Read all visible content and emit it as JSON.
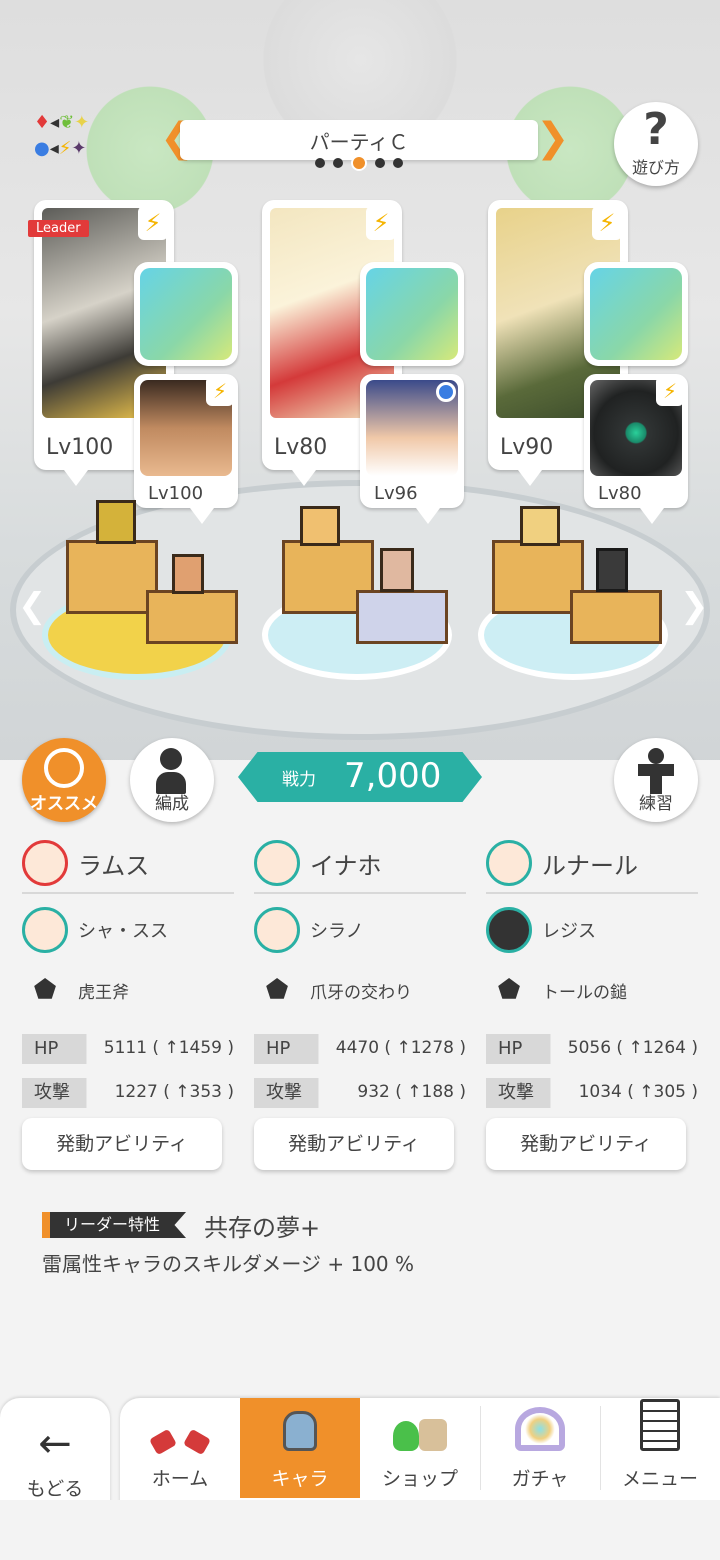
{
  "header": {
    "party_title": "パーティＣ",
    "page_dots": 5,
    "active_dot": 2,
    "help_label": "遊び方",
    "help_glyph": "?",
    "prev_glyph": "❮",
    "next_glyph": "❯"
  },
  "element_legend": [
    "♦",
    "◂",
    "❦",
    "✦",
    "●",
    "◂",
    "⚡",
    "✦"
  ],
  "leader_badge": "Leader",
  "bolt_glyph": "⚡",
  "stage_arrows": {
    "left": "❮",
    "right": "❯"
  },
  "party": [
    {
      "main_level": "Lv100",
      "sub_level": "Lv100"
    },
    {
      "main_level": "Lv80",
      "sub_level": "Lv96"
    },
    {
      "main_level": "Lv90",
      "sub_level": "Lv80"
    }
  ],
  "controls": {
    "recommend_label": "オススメ",
    "formation_label": "編成",
    "power_label": "戦力",
    "power_value": "7,000",
    "practice_label": "練習"
  },
  "columns": [
    {
      "main_name": "ラムス",
      "sub_name": "シャ・スス",
      "weapon": "虎王斧",
      "hp_label": "HP",
      "hp_value": "5111 ( ↑1459 )",
      "atk_label": "攻撃",
      "atk_value": "1227 ( ↑353 )",
      "ability_button": "発動アビリティ"
    },
    {
      "main_name": "イナホ",
      "sub_name": "シラノ",
      "weapon": "爪牙の交わり",
      "hp_label": "HP",
      "hp_value": "4470 ( ↑1278 )",
      "atk_label": "攻撃",
      "atk_value": "932 ( ↑188 )",
      "ability_button": "発動アビリティ"
    },
    {
      "main_name": "ルナール",
      "sub_name": "レジス",
      "weapon": "トールの鎚",
      "hp_label": "HP",
      "hp_value": "5056 ( ↑1264 )",
      "atk_label": "攻撃",
      "atk_value": "1034 ( ↑305 )",
      "ability_button": "発動アビリティ"
    }
  ],
  "leader_trait": {
    "tag": "リーダー特性",
    "name": "共存の夢+",
    "description": "雷属性キャラのスキルダメージ + 100 %"
  },
  "nav": {
    "back_label": "もどる",
    "back_glyph": "←",
    "tabs": [
      {
        "label": "ホーム",
        "icon": "home-icon"
      },
      {
        "label": "キャラ",
        "icon": "character-icon",
        "active": true
      },
      {
        "label": "ショップ",
        "icon": "shop-icon"
      },
      {
        "label": "ガチャ",
        "icon": "gacha-icon"
      },
      {
        "label": "メニュー",
        "icon": "menu-icon"
      }
    ]
  },
  "colors": {
    "accent": "#f0902a",
    "teal": "#2ab0a4",
    "leader_red": "#e23a3a",
    "bolt_yellow": "#f5b400"
  }
}
